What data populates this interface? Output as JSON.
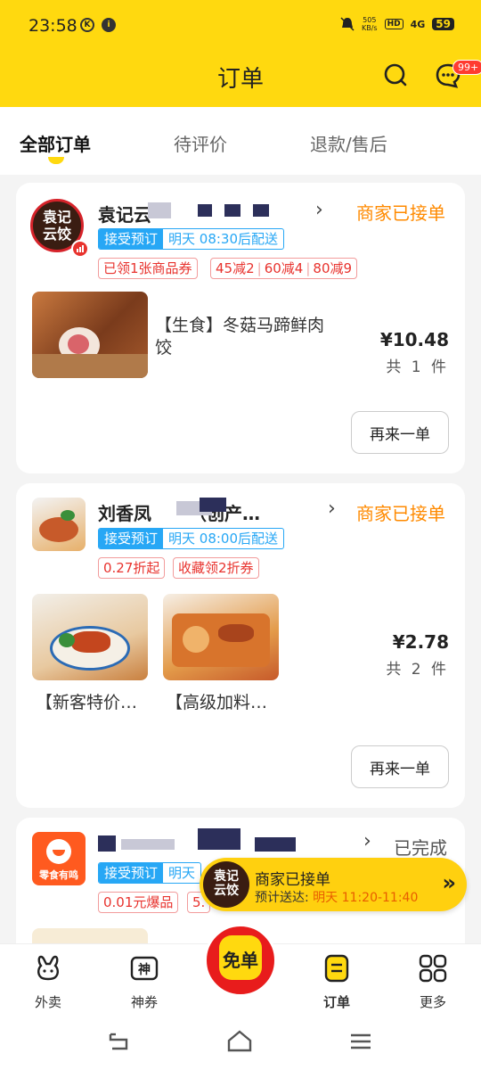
{
  "status_bar": {
    "time": "23:58",
    "net_speed_top": "505",
    "net_speed_bottom": "KB/s",
    "hd": "HD",
    "signal": "4G",
    "battery": "59"
  },
  "header": {
    "title": "订单",
    "message_badge": "99+"
  },
  "tabs": [
    {
      "label": "全部订单",
      "active": true
    },
    {
      "label": "待评价",
      "active": false
    },
    {
      "label": "退款/售后",
      "active": false
    }
  ],
  "orders": [
    {
      "shop_name": "袁记云",
      "status": "商家已接单",
      "logo_text": "袁记\n云饺",
      "preorder": {
        "label": "接受预订",
        "time": "明天  08:30后配送"
      },
      "promos": [
        "已领1张商品券",
        "45减2",
        "60减4",
        "80减9"
      ],
      "items": [
        {
          "name": "【生食】冬菇马蹄鲜肉饺"
        }
      ],
      "price": "¥10.48",
      "count": "共 1 件",
      "reorder_label": "再来一单"
    },
    {
      "shop_name": "刘香凤",
      "shop_name_tail": "（创产…",
      "status": "商家已接单",
      "preorder": {
        "label": "接受预订",
        "time": "明天  08:00后配送"
      },
      "promos": [
        "0.27折起",
        "收藏领2折券"
      ],
      "items": [
        {
          "name": "【新客特价…"
        },
        {
          "name": "【高级加料…"
        }
      ],
      "price": "¥2.78",
      "count": "共 2 件",
      "reorder_label": "再来一单"
    },
    {
      "shop_name": "零食有鸣",
      "status": "已完成",
      "preorder": {
        "label": "接受预订",
        "time": "明天"
      },
      "promos": [
        "0.01元爆品",
        "5."
      ]
    }
  ],
  "floating_banner": {
    "title": "商家已接单",
    "eta_label": "预计送达:",
    "eta_day": "明天",
    "eta_time": "11:20-11:40",
    "logo_text": "袁记\n云饺"
  },
  "bottom_nav": [
    {
      "label": "外卖"
    },
    {
      "label": "神券"
    },
    {
      "label": "免单"
    },
    {
      "label": "订单",
      "active": true
    },
    {
      "label": "更多"
    }
  ],
  "colors": {
    "brand_yellow": "#ffd90f",
    "accent_orange": "#ff8a00",
    "promo_red": "#e8332e",
    "preorder_blue": "#27a7f5"
  }
}
